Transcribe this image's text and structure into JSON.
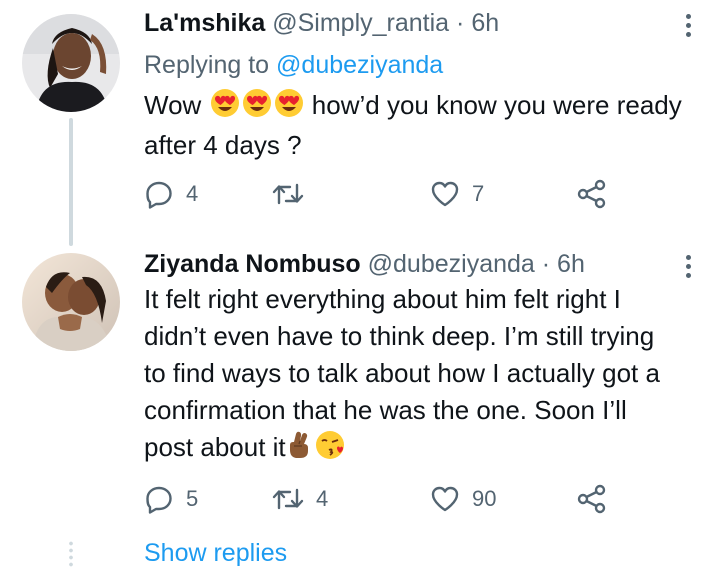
{
  "tweets": [
    {
      "name": "La'mshika",
      "handle": "@Simply_rantia",
      "separator": "·",
      "time": "6h",
      "replying_prefix": "Replying to",
      "replying_to": "@dubeziyanda",
      "text_lines": [
        {
          "before": "Wow",
          "emojis": [
            "heart-eyes",
            "heart-eyes",
            "heart-eyes"
          ],
          "after": "how’d you know you were ready"
        },
        {
          "text": "after 4 days ?"
        }
      ],
      "stats": {
        "replies": "4",
        "retweets": "",
        "likes": "7"
      }
    },
    {
      "name": "Ziyanda Nombuso",
      "handle": "@dubeziyanda",
      "separator": "·",
      "time": "6h",
      "text_lines": [
        {
          "text": "It felt right everything about him felt right I"
        },
        {
          "text": "didn’t even have to think deep. I’m still trying"
        },
        {
          "text": "to find ways to talk about how I actually got a"
        },
        {
          "text": "confirmation that he was the one. Soon I’ll"
        },
        {
          "before": "post about it",
          "emojis": [
            "crossed-fingers",
            "face-blowing-kiss"
          ],
          "after": ""
        }
      ],
      "stats": {
        "replies": "5",
        "retweets": "4",
        "likes": "90"
      }
    }
  ],
  "show_replies": "Show replies",
  "colors": {
    "text": "#0f1419",
    "secondary": "#536471",
    "accent": "#1d9bf0",
    "thread_line": "#cfd9de"
  }
}
